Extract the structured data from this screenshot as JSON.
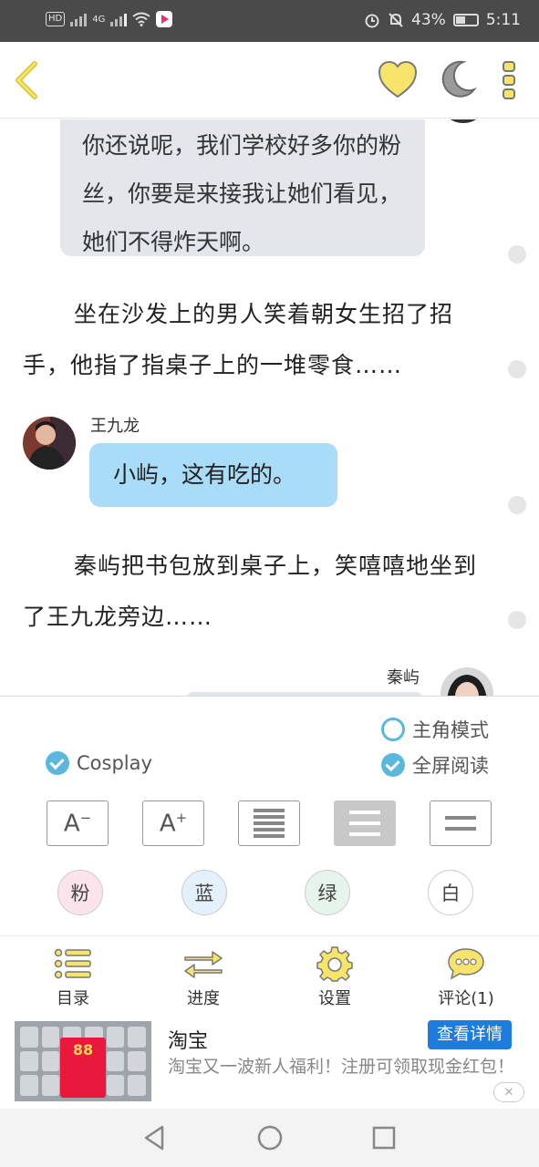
{
  "status_bar": {
    "network_badge": "HD",
    "signal_label": "4G",
    "battery_percent": "43%",
    "time": "5:11",
    "icons": [
      "hd-icon",
      "signal-icon",
      "wifi-icon",
      "video-app-icon",
      "alarm-icon",
      "mute-icon",
      "battery-icon"
    ]
  },
  "header": {
    "icons": [
      "back-chevron-icon",
      "heart-icon",
      "night-mode-moon-icon",
      "more-vertical-icon"
    ],
    "colors": {
      "accent": "#f7e46b",
      "moon": "#999999"
    }
  },
  "chat": {
    "top_bubble_text": "你还说呢，我们学校好多你的粉丝，你要是来接我让她们看见，她们不得炸天啊。",
    "narration_1": "坐在沙发上的男人笑着朝女生招了招手，他指了指桌子上的一堆零食……",
    "speaker_1_name": "王九龙",
    "speaker_1_message": "小屿，这有吃的。",
    "narration_2": "秦屿把书包放到桌子上，笑嘻嘻地坐到了王九龙旁边……",
    "speaker_2_name": "秦屿",
    "colors": {
      "grey_bubble": "#e3e6ea",
      "blue_bubble": "#a8dcf8"
    }
  },
  "settings": {
    "protagonist_mode_label": "主角模式",
    "protagonist_mode_checked": false,
    "cosplay_label": "Cosplay",
    "cosplay_checked": true,
    "fullscreen_label": "全屏阅读",
    "fullscreen_checked": true,
    "font_smaller_label": "A",
    "font_larger_label": "A",
    "line_spacing_selected": 2,
    "theme_pink_label": "粉",
    "theme_blue_label": "蓝",
    "theme_green_label": "绿",
    "theme_white_label": "白",
    "colors": {
      "check_accent": "#5bb8dc",
      "pink": "#fbe4ec",
      "blue": "#e2f1fb",
      "green": "#e6f4ec",
      "white": "#ffffff"
    }
  },
  "toolbar": {
    "catalog_label": "目录",
    "progress_label": "进度",
    "settings_label": "设置",
    "comments_label": "评论(1)",
    "icons": [
      "catalog-list-icon",
      "progress-arrows-icon",
      "settings-gear-icon",
      "comment-bubble-icon"
    ],
    "colors": {
      "icon": "#e0c93a"
    }
  },
  "ad": {
    "title": "淘宝",
    "cta_label": "查看详情",
    "description": "淘宝又一波新人福利！注册可领取现金红包！",
    "image_amount": "88"
  },
  "nav": {
    "icons": [
      "nav-back-icon",
      "nav-home-icon",
      "nav-recents-icon"
    ]
  }
}
